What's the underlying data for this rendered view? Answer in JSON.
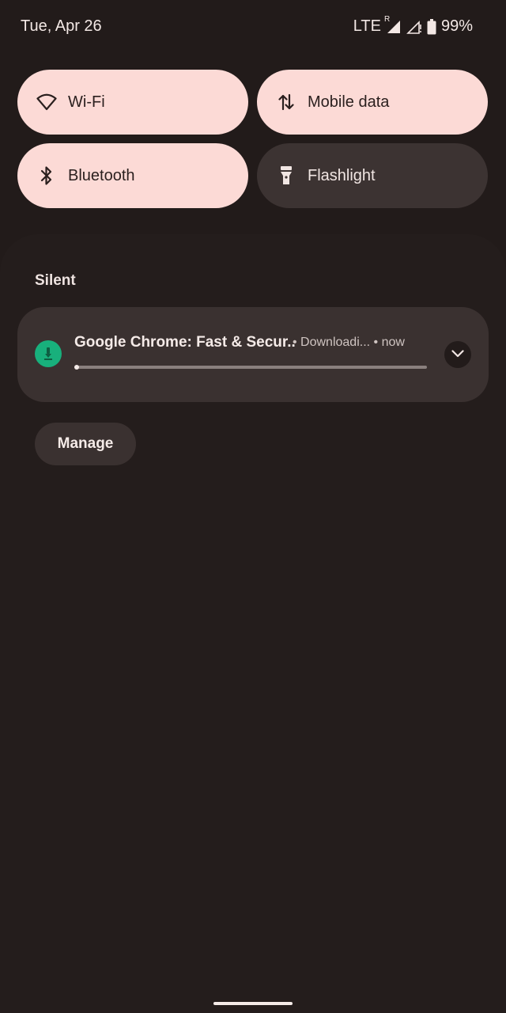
{
  "status_bar": {
    "date": "Tue, Apr 26",
    "network": "LTE",
    "roaming_indicator": "R",
    "battery": "99%",
    "icons": [
      "signal-icon",
      "signal-empty-icon",
      "battery-icon"
    ]
  },
  "quick_tiles": [
    {
      "label": "Wi-Fi",
      "icon": "wifi-icon",
      "state": "on"
    },
    {
      "label": "Mobile data",
      "icon": "mobile-data-icon",
      "state": "on"
    },
    {
      "label": "Bluetooth",
      "icon": "bluetooth-icon",
      "state": "on"
    },
    {
      "label": "Flashlight",
      "icon": "flashlight-icon",
      "state": "off"
    }
  ],
  "notifications": {
    "section_title": "Silent",
    "items": [
      {
        "app_icon": "app-icon",
        "title": "Google Chrome: Fast & Secur..",
        "meta": "• Downloadi... • now",
        "progress": 0.01
      }
    ],
    "manage_label": "Manage"
  },
  "colors": {
    "background": "#221b1a",
    "tile_on": "#fcdad6",
    "tile_off": "#3c3332",
    "card": "#3a3130",
    "app_icon": "#18b07c"
  }
}
